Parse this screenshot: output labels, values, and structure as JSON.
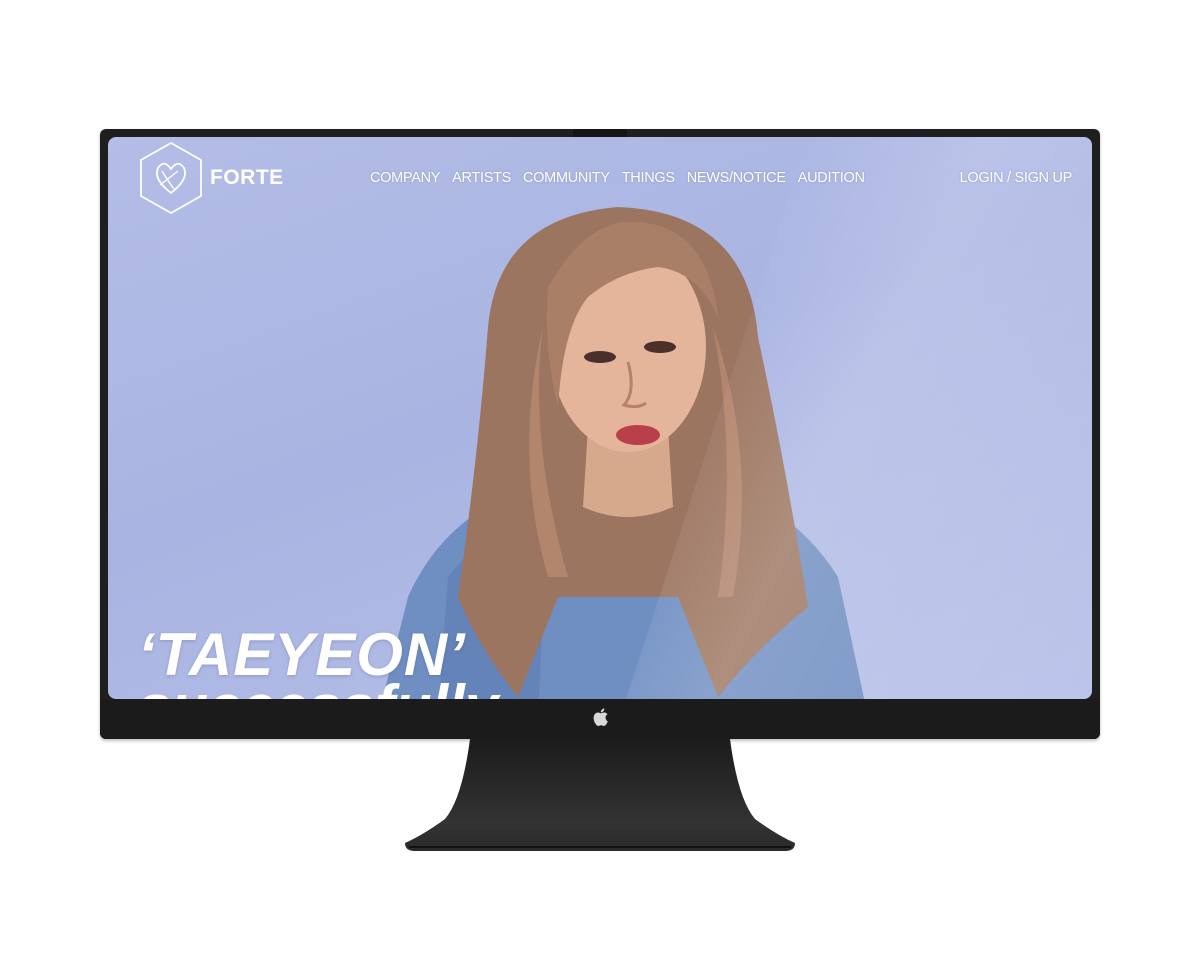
{
  "brand": {
    "name": "FORTE",
    "logo_icon": "hexagon-heart-logo-icon"
  },
  "nav": {
    "items": [
      {
        "label": "COMPANY"
      },
      {
        "label": "ARTISTS"
      },
      {
        "label": "COMMUNITY"
      },
      {
        "label": "THINGS"
      },
      {
        "label": "NEWS/NOTICE"
      },
      {
        "label": "AUDITION"
      }
    ],
    "auth_label": "LOGIN / SIGN UP"
  },
  "hero": {
    "headline": "‘TAEYEON’",
    "subline": "successfully"
  },
  "device": {
    "brand_icon": "apple-logo-icon"
  },
  "colors": {
    "sky": "#aeb8e4",
    "bezel": "#1f1f1f",
    "text": "#ffffff"
  }
}
